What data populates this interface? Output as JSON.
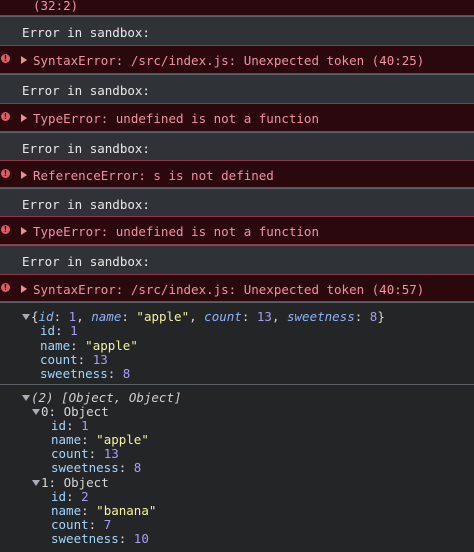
{
  "top_partial": "(32:2)",
  "messages": [
    {
      "label": "Error in sandbox:",
      "error": "SyntaxError: /src/index.js: Unexpected token (40:25)"
    },
    {
      "label": "Error in sandbox:",
      "error": "TypeError: undefined is not a function"
    },
    {
      "label": "Error in sandbox:",
      "error": "ReferenceError: s is not defined"
    },
    {
      "label": "Error in sandbox:",
      "error": "TypeError: undefined is not a function"
    },
    {
      "label": "Error in sandbox:",
      "error": "SyntaxError: /src/index.js: Unexpected token (40:57)"
    }
  ],
  "object_log": {
    "brace_open": "{",
    "brace_close": "}",
    "summary": [
      {
        "k": "id",
        "v": "1",
        "t": "num"
      },
      {
        "k": "name",
        "v": "\"apple\"",
        "t": "str"
      },
      {
        "k": "count",
        "v": "13",
        "t": "num"
      },
      {
        "k": "sweetness",
        "v": "8",
        "t": "num"
      }
    ],
    "props": [
      {
        "k": "id",
        "v": "1",
        "t": "num"
      },
      {
        "k": "name",
        "v": "\"apple\"",
        "t": "str"
      },
      {
        "k": "count",
        "v": "13",
        "t": "num"
      },
      {
        "k": "sweetness",
        "v": "8",
        "t": "num"
      }
    ]
  },
  "array_log": {
    "summary": "(2) [Object, Object]",
    "items": [
      {
        "header": "0: Object",
        "props": [
          {
            "k": "id",
            "v": "1",
            "t": "num"
          },
          {
            "k": "name",
            "v": "\"apple\"",
            "t": "str"
          },
          {
            "k": "count",
            "v": "13",
            "t": "num"
          },
          {
            "k": "sweetness",
            "v": "8",
            "t": "num"
          }
        ]
      },
      {
        "header": "1: Object",
        "props": [
          {
            "k": "id",
            "v": "2",
            "t": "num"
          },
          {
            "k": "name",
            "v": "\"banana\"",
            "t": "str"
          },
          {
            "k": "count",
            "v": "7",
            "t": "num"
          },
          {
            "k": "sweetness",
            "v": "10",
            "t": "num"
          }
        ]
      }
    ]
  },
  "colors": {
    "error_text": "#f48fa0",
    "error_bg": "#2a080c",
    "number": "#a89cf5",
    "string": "#f2f2a0",
    "key": "#9fd7ff"
  }
}
